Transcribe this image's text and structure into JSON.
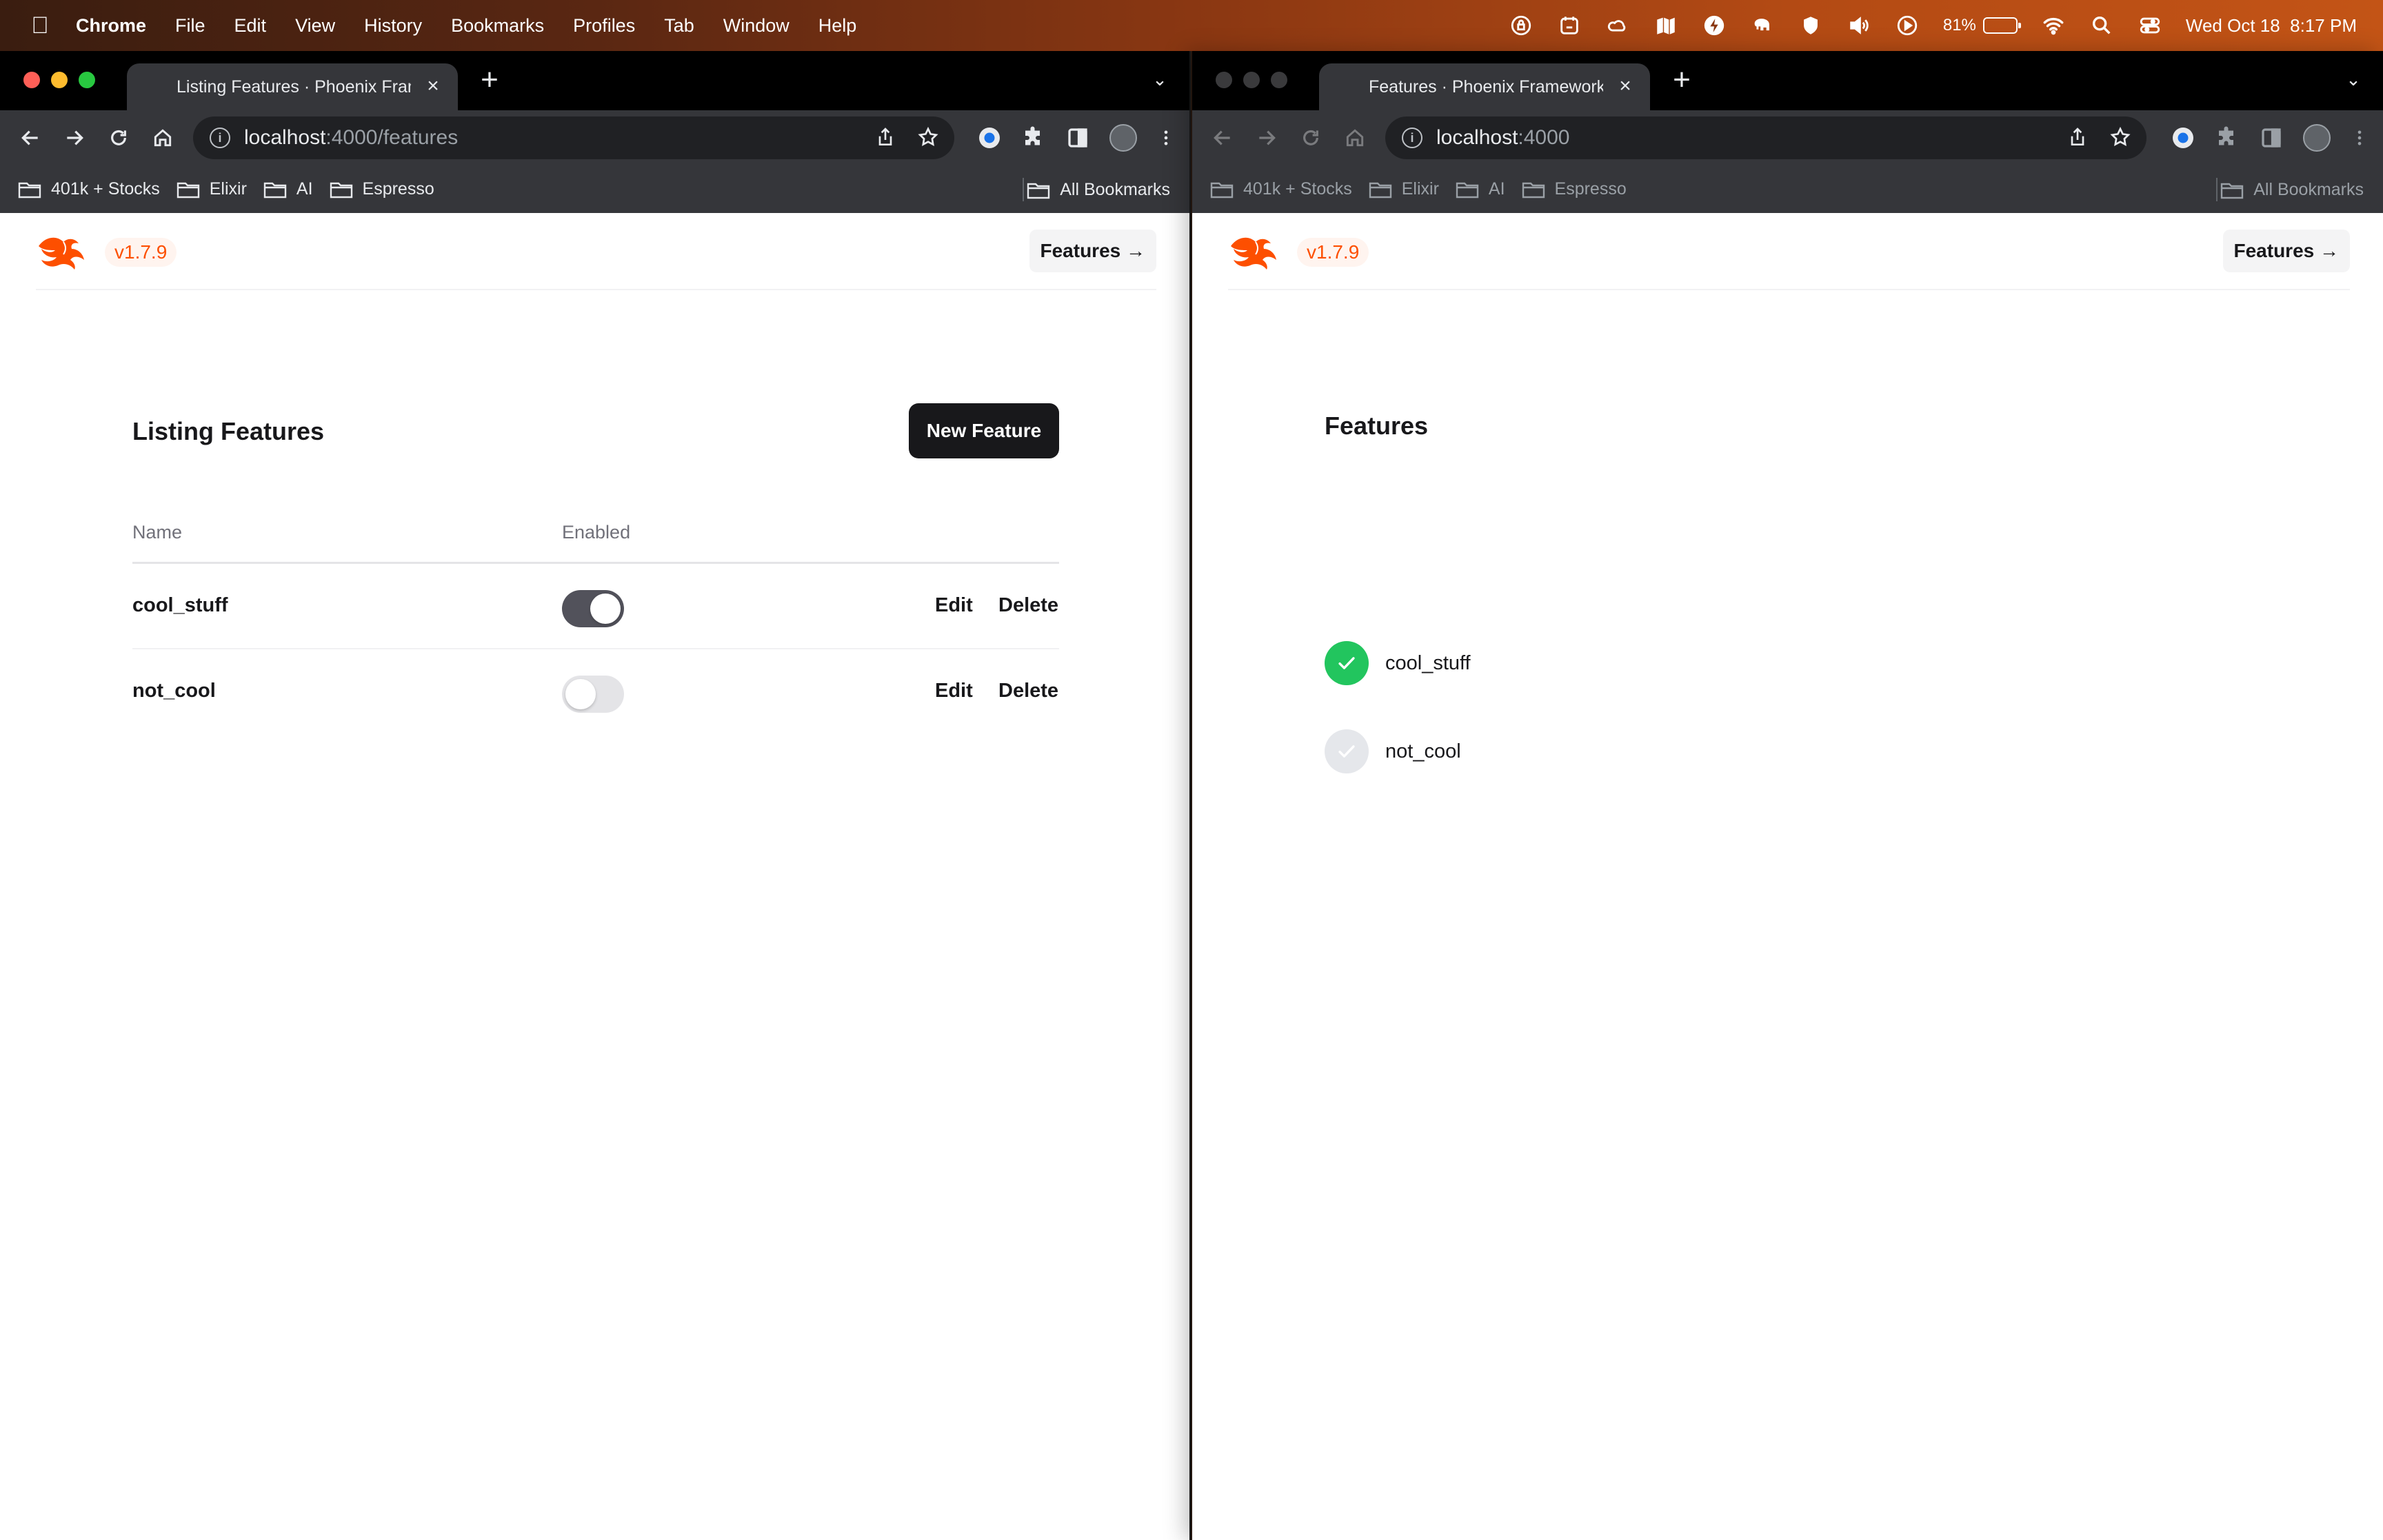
{
  "menubar": {
    "app": "Chrome",
    "items": [
      "File",
      "Edit",
      "View",
      "History",
      "Bookmarks",
      "Profiles",
      "Tab",
      "Window",
      "Help"
    ],
    "battery": "81%",
    "battery_level": 0.81,
    "datetime": "Wed Oct 18  8:17 PM"
  },
  "left_window": {
    "tab_title": "Listing Features · Phoenix Framework",
    "url_host": "localhost",
    "url_path": ":4000/features",
    "bookmarks": [
      "401k + Stocks",
      "Elixir",
      "AI",
      "Espresso"
    ],
    "all_bookmarks": "All Bookmarks",
    "header": {
      "version": "v1.7.9",
      "nav_label": "Features →"
    },
    "listing": {
      "title": "Listing Features",
      "new_button": "New Feature",
      "columns": [
        "Name",
        "Enabled"
      ],
      "rows": [
        {
          "name": "cool_stuff",
          "enabled": true,
          "edit": "Edit",
          "delete": "Delete"
        },
        {
          "name": "not_cool",
          "enabled": false,
          "edit": "Edit",
          "delete": "Delete"
        }
      ]
    }
  },
  "right_window": {
    "tab_title": "Features · Phoenix Framework",
    "url_host": "localhost",
    "url_path": ":4000",
    "bookmarks": [
      "401k + Stocks",
      "Elixir",
      "AI",
      "Espresso"
    ],
    "all_bookmarks": "All Bookmarks",
    "header": {
      "version": "v1.7.9",
      "nav_label": "Features →"
    },
    "features": {
      "title": "Features",
      "items": [
        {
          "name": "cool_stuff",
          "enabled": true
        },
        {
          "name": "not_cool",
          "enabled": false
        }
      ]
    }
  },
  "colors": {
    "phoenix_orange": "#fd4f00",
    "toggle_on": "#52525b",
    "check_on": "#22c55e"
  }
}
